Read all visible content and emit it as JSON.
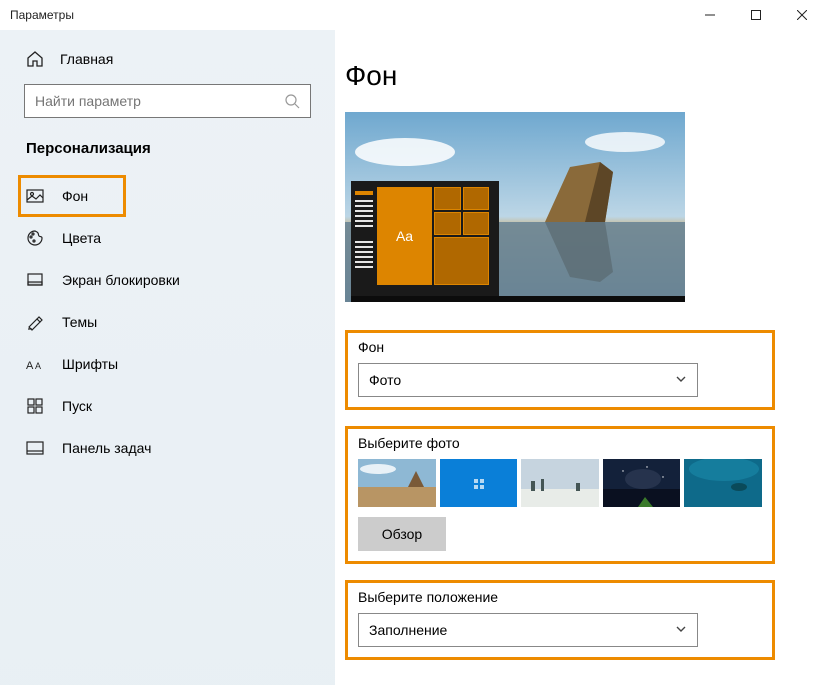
{
  "window": {
    "title": "Параметры"
  },
  "sidebar": {
    "home": "Главная",
    "search_placeholder": "Найти параметр",
    "section": "Персонализация",
    "items": [
      {
        "label": "Фон",
        "icon": "picture-icon",
        "selected": true
      },
      {
        "label": "Цвета",
        "icon": "palette-icon",
        "selected": false
      },
      {
        "label": "Экран блокировки",
        "icon": "lockscreen-icon",
        "selected": false
      },
      {
        "label": "Темы",
        "icon": "themes-icon",
        "selected": false
      },
      {
        "label": "Шрифты",
        "icon": "fonts-icon",
        "selected": false
      },
      {
        "label": "Пуск",
        "icon": "start-icon",
        "selected": false
      },
      {
        "label": "Панель задач",
        "icon": "taskbar-icon",
        "selected": false
      }
    ]
  },
  "page": {
    "title": "Фон",
    "preview_sample_text": "Aa",
    "background_section": {
      "label": "Фон",
      "dropdown_value": "Фото"
    },
    "choose_photo_section": {
      "label": "Выберите фото",
      "browse_label": "Обзор",
      "thumbnails": [
        "beach",
        "blue-windows",
        "winter",
        "night-sky",
        "underwater"
      ]
    },
    "fit_section": {
      "label": "Выберите положение",
      "dropdown_value": "Заполнение"
    }
  },
  "colors": {
    "highlight": "#ed8b00",
    "tile": "#dd8500"
  }
}
